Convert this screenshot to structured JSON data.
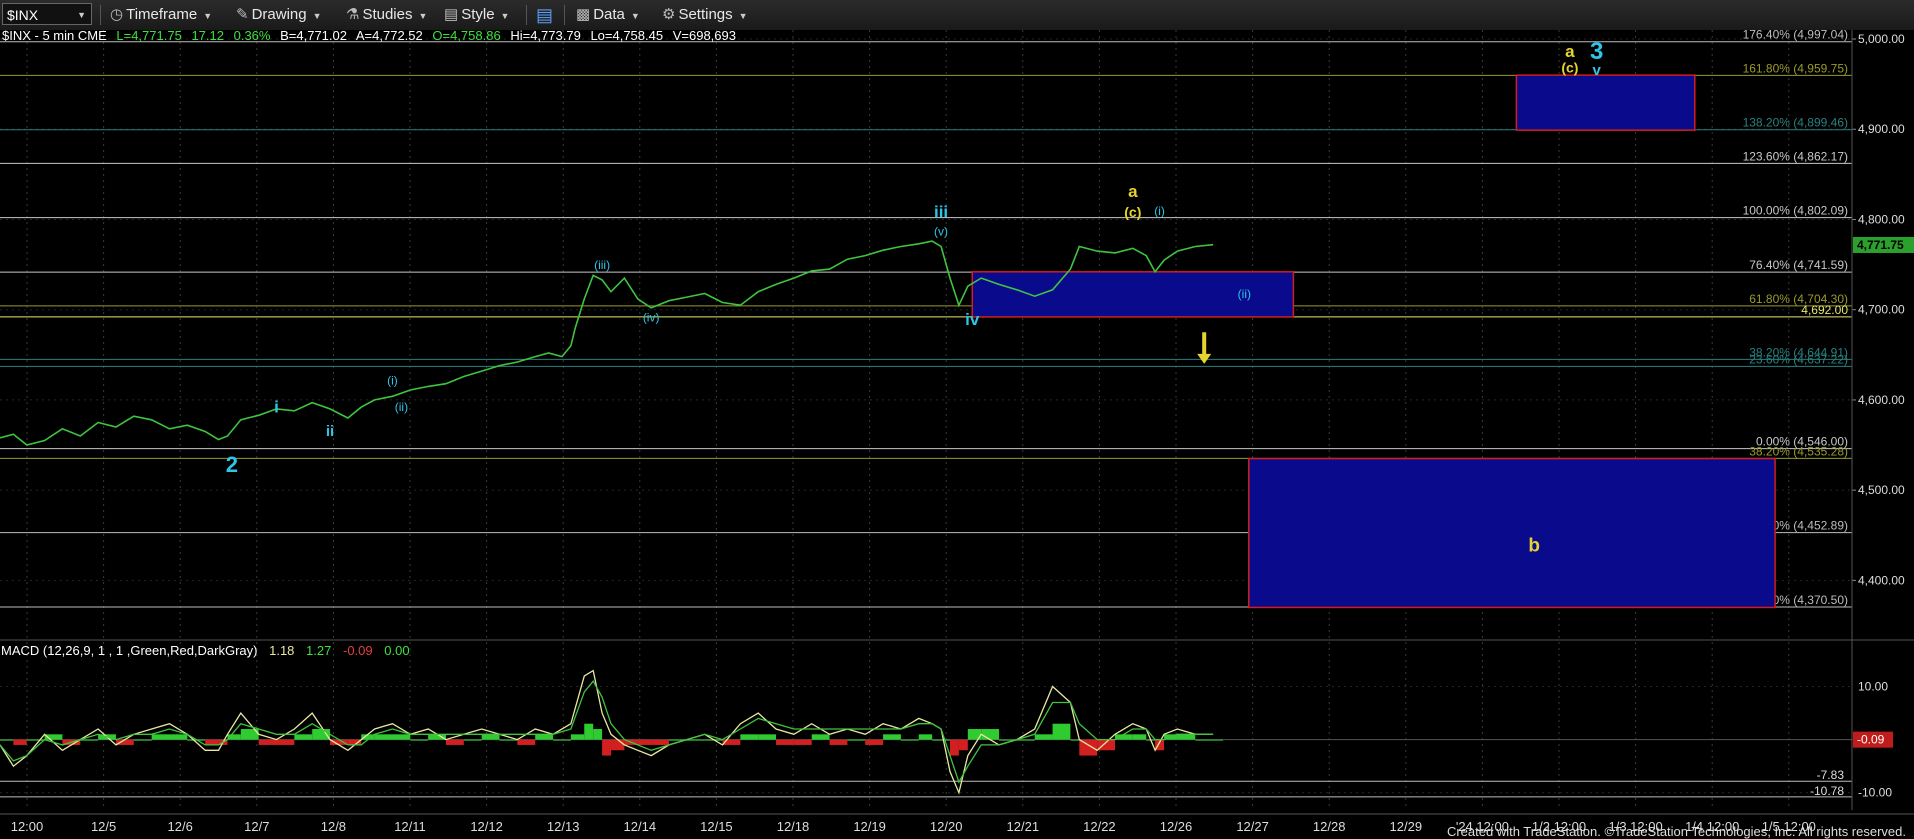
{
  "toolbar": {
    "symbol": "$INX",
    "timeframe": "Timeframe",
    "drawing": "Drawing",
    "studies": "Studies",
    "style": "Style",
    "data": "Data",
    "settings": "Settings"
  },
  "header": {
    "symbol_info": "$INX - 5 min  CME",
    "last": "L=4,771.75",
    "change": "17.12",
    "pct": "0.36%",
    "bid": "B=4,771.02",
    "ask": "A=4,772.52",
    "open": "O=4,758.86",
    "high": "Hi=4,773.79",
    "low": "Lo=4,758.45",
    "volume": "V=698,693"
  },
  "macd_header": {
    "title": "MACD (12,26,9, 1 , 1 ,Green,Red,DarkGray)",
    "v1": "1.18",
    "v2": "1.27",
    "v3": "-0.09",
    "v4": "0.00"
  },
  "footer": "Created with TradeStation. ©TradeStation Technologies, Inc. All rights reserved.",
  "colors": {
    "price": "#3fc43f",
    "wave_blue": "#2ec5e6",
    "wave_yellow": "#e6d32e",
    "box_fill": "#0a0a8c",
    "box_border": "#d21e1e",
    "macd_line": "#e8e8a0",
    "signal_line": "#3fc43f",
    "hist_pos": "#2ecc2e",
    "hist_neg": "#d22020"
  },
  "chart_data": {
    "type": "line",
    "price_axis": {
      "ylim": [
        4345,
        5010
      ],
      "ticks": [
        {
          "value": 5000,
          "label": "5,000.00"
        },
        {
          "value": 4900,
          "label": "4,900.00"
        },
        {
          "value": 4800,
          "label": "4,800.00"
        },
        {
          "value": 4700,
          "label": "4,700.00"
        },
        {
          "value": 4600,
          "label": "4,600.00"
        },
        {
          "value": 4500,
          "label": "4,500.00"
        },
        {
          "value": 4400,
          "label": "4,400.00"
        }
      ],
      "last_price": 4771.75,
      "last_label": "4,771.75"
    },
    "x_axis": {
      "ticks": [
        "12:00",
        "12/5",
        "12/6",
        "12/7",
        "12/8",
        "12/11",
        "12/12",
        "12/13",
        "12/14",
        "12/15",
        "12/18",
        "12/19",
        "12/20",
        "12/21",
        "12/22",
        "12/26",
        "12/27",
        "12/28",
        "12/29",
        "'24 12:00",
        "1/2 12:00",
        "1/3 12:00",
        "1/4 12:00",
        "1/5 12:00"
      ]
    },
    "price_series": [
      [
        0,
        4558
      ],
      [
        3,
        4562
      ],
      [
        6,
        4550
      ],
      [
        10,
        4555
      ],
      [
        14,
        4568
      ],
      [
        18,
        4560
      ],
      [
        22,
        4575
      ],
      [
        26,
        4570
      ],
      [
        30,
        4582
      ],
      [
        34,
        4578
      ],
      [
        38,
        4568
      ],
      [
        42,
        4572
      ],
      [
        46,
        4565
      ],
      [
        49,
        4556
      ],
      [
        51,
        4560
      ],
      [
        54,
        4578
      ],
      [
        58,
        4583
      ],
      [
        62,
        4590
      ],
      [
        66,
        4588
      ],
      [
        70,
        4597
      ],
      [
        74,
        4590
      ],
      [
        78,
        4580
      ],
      [
        81,
        4592
      ],
      [
        84,
        4600
      ],
      [
        88,
        4604
      ],
      [
        92,
        4611
      ],
      [
        96,
        4615
      ],
      [
        100,
        4618
      ],
      [
        104,
        4626
      ],
      [
        108,
        4632
      ],
      [
        112,
        4638
      ],
      [
        116,
        4642
      ],
      [
        120,
        4648
      ],
      [
        123,
        4652
      ],
      [
        126,
        4648
      ],
      [
        128,
        4660
      ],
      [
        129,
        4680
      ],
      [
        131,
        4712
      ],
      [
        133,
        4738
      ],
      [
        135,
        4733
      ],
      [
        137,
        4720
      ],
      [
        140,
        4735
      ],
      [
        143,
        4712
      ],
      [
        146,
        4702
      ],
      [
        150,
        4710
      ],
      [
        154,
        4714
      ],
      [
        158,
        4718
      ],
      [
        162,
        4708
      ],
      [
        166,
        4705
      ],
      [
        170,
        4720
      ],
      [
        174,
        4728
      ],
      [
        178,
        4735
      ],
      [
        182,
        4743
      ],
      [
        186,
        4745
      ],
      [
        190,
        4756
      ],
      [
        194,
        4760
      ],
      [
        198,
        4766
      ],
      [
        202,
        4770
      ],
      [
        206,
        4773
      ],
      [
        209,
        4776
      ],
      [
        211,
        4770
      ],
      [
        213,
        4735
      ],
      [
        215,
        4705
      ],
      [
        217,
        4726
      ],
      [
        220,
        4735
      ],
      [
        224,
        4728
      ],
      [
        228,
        4722
      ],
      [
        232,
        4715
      ],
      [
        236,
        4722
      ],
      [
        240,
        4745
      ],
      [
        242,
        4770
      ],
      [
        246,
        4765
      ],
      [
        250,
        4763
      ],
      [
        254,
        4768
      ],
      [
        257,
        4760
      ],
      [
        259,
        4742
      ],
      [
        261,
        4755
      ],
      [
        264,
        4765
      ],
      [
        268,
        4770
      ],
      [
        272,
        4772
      ]
    ],
    "fib_levels": [
      {
        "value": 4997.04,
        "label": "176.40% (4,997.04)",
        "color": "#bdbdbd"
      },
      {
        "value": 4959.75,
        "label": "161.80% (4,959.75)",
        "color": "#9a9a2a"
      },
      {
        "value": 4899.46,
        "label": "138.20% (4,899.46)",
        "color": "#2a8080"
      },
      {
        "value": 4862.17,
        "label": "123.60% (4,862.17)",
        "color": "#c8c8c8"
      },
      {
        "value": 4802.09,
        "label": "100.00% (4,802.09)",
        "color": "#c8c8c8"
      },
      {
        "value": 4741.59,
        "label": "76.40% (4,741.59)",
        "color": "#c8c8c8"
      },
      {
        "value": 4704.3,
        "label": "61.80% (4,704.30)",
        "color": "#9a9a2a"
      },
      {
        "value": 4692.0,
        "label": "4,692.00",
        "color": "#e6e66a"
      },
      {
        "value": 4644.91,
        "label": "38.20% (4,644.91)",
        "color": "#2a8080"
      },
      {
        "value": 4637.22,
        "label": "23.60% (4,637.22)",
        "color": "#2a8080"
      },
      {
        "value": 4546.0,
        "label": "0.00% (4,546.00)",
        "color": "#c8c8c8"
      },
      {
        "value": 4535.28,
        "label": "38.20% (4,535.28)",
        "color": "#9a9a2a"
      },
      {
        "value": 4452.89,
        "label": "50.00% (4,452.89)",
        "color": "#bdbdbd"
      },
      {
        "value": 4370.5,
        "label": "61.80% (4,370.50)",
        "color": "#bdbdbd"
      }
    ],
    "boxes": [
      {
        "x1": 218,
        "x2": 290,
        "y1": 4692,
        "y2": 4742
      },
      {
        "x1": 340,
        "x2": 380,
        "y1": 4899,
        "y2": 4960
      },
      {
        "x1": 280,
        "x2": 398,
        "y1": 4370,
        "y2": 4535
      }
    ],
    "wave_labels": [
      {
        "text": "2",
        "x": 52,
        "v": 4520,
        "color": "wave_blue",
        "size": 22,
        "bold": true
      },
      {
        "text": "i",
        "x": 62,
        "v": 4586,
        "color": "wave_blue",
        "size": 17,
        "bold": true
      },
      {
        "text": "ii",
        "x": 74,
        "v": 4560,
        "color": "wave_blue",
        "size": 15,
        "bold": true
      },
      {
        "text": "(i)",
        "x": 88,
        "v": 4617,
        "color": "wave_blue",
        "size": 12,
        "bold": false
      },
      {
        "text": "(ii)",
        "x": 90,
        "v": 4588,
        "color": "wave_blue",
        "size": 12,
        "bold": false
      },
      {
        "text": "(iii)",
        "x": 135,
        "v": 4745,
        "color": "wave_blue",
        "size": 12,
        "bold": false
      },
      {
        "text": "(iv)",
        "x": 146,
        "v": 4687,
        "color": "wave_blue",
        "size": 12,
        "bold": false
      },
      {
        "text": "iii",
        "x": 211,
        "v": 4802,
        "color": "wave_blue",
        "size": 17,
        "bold": true
      },
      {
        "text": "(v)",
        "x": 211,
        "v": 4782,
        "color": "wave_blue",
        "size": 12,
        "bold": false
      },
      {
        "text": "iv",
        "x": 218,
        "v": 4683,
        "color": "wave_blue",
        "size": 17,
        "bold": true
      },
      {
        "text": "a",
        "x": 254,
        "v": 4825,
        "color": "wave_yellow",
        "size": 17,
        "bold": true
      },
      {
        "text": "(c)",
        "x": 254,
        "v": 4803,
        "color": "wave_yellow",
        "size": 14,
        "bold": true
      },
      {
        "text": "(i)",
        "x": 260,
        "v": 4805,
        "color": "wave_blue",
        "size": 12,
        "bold": false
      },
      {
        "text": "(ii)",
        "x": 279,
        "v": 4713,
        "color": "wave_blue",
        "size": 12,
        "bold": false
      },
      {
        "text": "a",
        "x": 352,
        "v": 4980,
        "color": "wave_yellow",
        "size": 17,
        "bold": true
      },
      {
        "text": "(c)",
        "x": 352,
        "v": 4963,
        "color": "wave_yellow",
        "size": 14,
        "bold": true
      },
      {
        "text": "3",
        "x": 358,
        "v": 4978,
        "color": "wave_blue",
        "size": 24,
        "bold": true
      },
      {
        "text": "v",
        "x": 358,
        "v": 4960,
        "color": "wave_blue",
        "size": 15,
        "bold": true
      },
      {
        "text": "b",
        "x": 344,
        "v": 4432,
        "color": "wave_yellow",
        "size": 19,
        "bold": true
      }
    ],
    "arrow": {
      "x": 270,
      "from": 4675,
      "to": 4640
    },
    "macd": {
      "ylim": [
        -12.5,
        15
      ],
      "ticks": [
        {
          "value": 10,
          "label": "10.00"
        },
        {
          "value": -10,
          "label": "-10.00"
        }
      ],
      "ref_levels": [
        {
          "value": -7.83,
          "label": "-7.83"
        },
        {
          "value": -10.78,
          "label": "-10.78"
        }
      ],
      "last_hist_label": "-0.09",
      "macd_line": [
        [
          0,
          -1
        ],
        [
          3,
          -5
        ],
        [
          6,
          -3
        ],
        [
          10,
          1
        ],
        [
          14,
          -2
        ],
        [
          18,
          0
        ],
        [
          22,
          2
        ],
        [
          26,
          -1
        ],
        [
          30,
          1
        ],
        [
          34,
          2
        ],
        [
          38,
          3
        ],
        [
          42,
          1
        ],
        [
          46,
          -2
        ],
        [
          49,
          -2
        ],
        [
          51,
          1
        ],
        [
          54,
          5
        ],
        [
          58,
          1
        ],
        [
          62,
          0
        ],
        [
          66,
          2
        ],
        [
          70,
          5
        ],
        [
          74,
          0
        ],
        [
          78,
          -2
        ],
        [
          81,
          0
        ],
        [
          84,
          2
        ],
        [
          88,
          3
        ],
        [
          92,
          1
        ],
        [
          96,
          2
        ],
        [
          100,
          0
        ],
        [
          104,
          1
        ],
        [
          108,
          2
        ],
        [
          112,
          1
        ],
        [
          116,
          0
        ],
        [
          120,
          2
        ],
        [
          124,
          1
        ],
        [
          128,
          3
        ],
        [
          131,
          12
        ],
        [
          133,
          13
        ],
        [
          135,
          5
        ],
        [
          137,
          1
        ],
        [
          140,
          -1
        ],
        [
          143,
          -2
        ],
        [
          146,
          -3
        ],
        [
          150,
          -1
        ],
        [
          154,
          0
        ],
        [
          158,
          1
        ],
        [
          162,
          -1
        ],
        [
          166,
          3
        ],
        [
          170,
          5
        ],
        [
          174,
          2
        ],
        [
          178,
          1
        ],
        [
          182,
          3
        ],
        [
          186,
          1
        ],
        [
          190,
          2
        ],
        [
          194,
          1
        ],
        [
          198,
          3
        ],
        [
          202,
          2
        ],
        [
          206,
          4
        ],
        [
          209,
          3
        ],
        [
          211,
          2
        ],
        [
          213,
          -6
        ],
        [
          215,
          -10
        ],
        [
          217,
          -3
        ],
        [
          220,
          1
        ],
        [
          224,
          -1
        ],
        [
          228,
          0
        ],
        [
          232,
          2
        ],
        [
          236,
          10
        ],
        [
          240,
          7
        ],
        [
          242,
          0
        ],
        [
          246,
          -2
        ],
        [
          250,
          1
        ],
        [
          254,
          3
        ],
        [
          257,
          2
        ],
        [
          259,
          -2
        ],
        [
          261,
          1
        ],
        [
          264,
          2
        ],
        [
          268,
          1
        ],
        [
          272,
          1
        ]
      ],
      "signal_line": [
        [
          0,
          -1
        ],
        [
          3,
          -4
        ],
        [
          6,
          -3
        ],
        [
          10,
          0
        ],
        [
          14,
          -1
        ],
        [
          18,
          0
        ],
        [
          22,
          1
        ],
        [
          26,
          0
        ],
        [
          30,
          1
        ],
        [
          34,
          1
        ],
        [
          38,
          2
        ],
        [
          42,
          1
        ],
        [
          46,
          -1
        ],
        [
          49,
          -1
        ],
        [
          51,
          0
        ],
        [
          54,
          3
        ],
        [
          58,
          2
        ],
        [
          62,
          1
        ],
        [
          66,
          1
        ],
        [
          70,
          3
        ],
        [
          74,
          1
        ],
        [
          78,
          -1
        ],
        [
          81,
          -1
        ],
        [
          84,
          1
        ],
        [
          88,
          2
        ],
        [
          92,
          1
        ],
        [
          96,
          1
        ],
        [
          100,
          1
        ],
        [
          104,
          1
        ],
        [
          108,
          1
        ],
        [
          112,
          1
        ],
        [
          116,
          1
        ],
        [
          120,
          1
        ],
        [
          124,
          1
        ],
        [
          128,
          2
        ],
        [
          131,
          9
        ],
        [
          133,
          11
        ],
        [
          135,
          8
        ],
        [
          137,
          3
        ],
        [
          140,
          0
        ],
        [
          143,
          -1
        ],
        [
          146,
          -2
        ],
        [
          150,
          -1
        ],
        [
          154,
          0
        ],
        [
          158,
          1
        ],
        [
          162,
          0
        ],
        [
          166,
          2
        ],
        [
          170,
          4
        ],
        [
          174,
          3
        ],
        [
          178,
          2
        ],
        [
          182,
          2
        ],
        [
          186,
          2
        ],
        [
          190,
          2
        ],
        [
          194,
          2
        ],
        [
          198,
          2
        ],
        [
          202,
          2
        ],
        [
          206,
          3
        ],
        [
          209,
          3
        ],
        [
          211,
          2
        ],
        [
          213,
          -3
        ],
        [
          215,
          -8
        ],
        [
          217,
          -5
        ],
        [
          220,
          -1
        ],
        [
          224,
          -1
        ],
        [
          228,
          0
        ],
        [
          232,
          1
        ],
        [
          236,
          7
        ],
        [
          240,
          7
        ],
        [
          242,
          3
        ],
        [
          246,
          0
        ],
        [
          250,
          0
        ],
        [
          254,
          2
        ],
        [
          257,
          2
        ],
        [
          259,
          0
        ],
        [
          261,
          0
        ],
        [
          264,
          1
        ],
        [
          268,
          1
        ],
        [
          272,
          1
        ]
      ]
    }
  }
}
